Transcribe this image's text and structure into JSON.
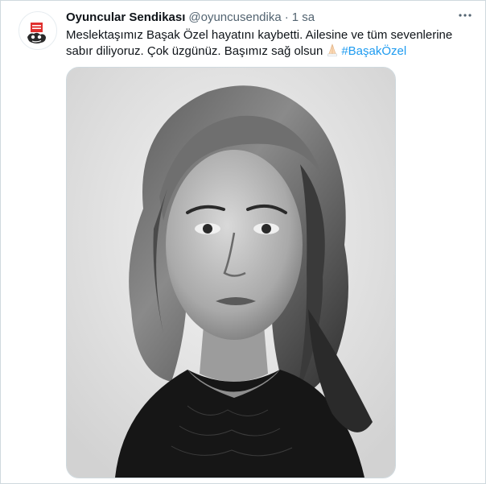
{
  "tweet": {
    "author": {
      "display_name": "Oyuncular Sendikası",
      "handle": "@oyuncusendika",
      "avatar_icon": "union-logo-icon"
    },
    "separator": "·",
    "timestamp": "1 sa",
    "text": {
      "line1": "Meslektaşımız Başak Özel hayatını kaybetti. Ailesine ve tüm sevenlerine",
      "line2": "sabır diliyoruz. Çok üzgünüz. Başımız sağ olsun",
      "emoji": "folded-hands-emoji",
      "hashtag": "#BaşakÖzel"
    },
    "media": {
      "type": "black-and-white portrait photo"
    },
    "more_icon": "more-horizontal-icon"
  },
  "colors": {
    "text_primary": "#0f1419",
    "text_secondary": "#536471",
    "link": "#1d9bf0",
    "border": "#cfd9de"
  }
}
